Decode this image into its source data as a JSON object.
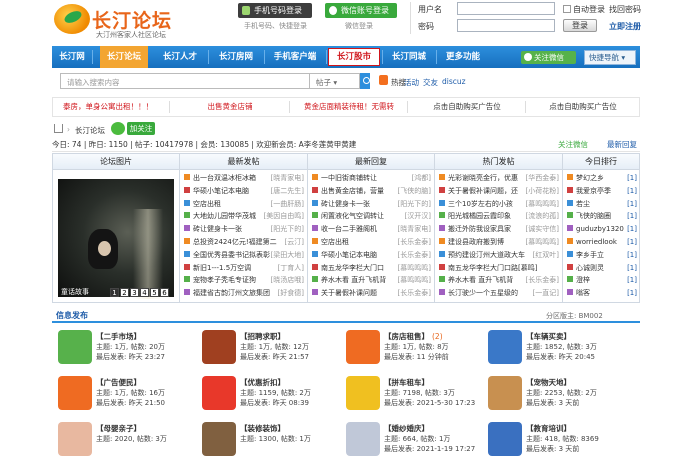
{
  "header": {
    "logo_title": "长汀论坛",
    "logo_sub": "大汀州客家人社区论坛",
    "phone_login": "手机号码登录",
    "wx_login": "微信账号登录",
    "phone_hint": "手机号码、快捷登录",
    "wx_hint": "微信登录",
    "user_label": "用户名",
    "pwd_label": "密码",
    "auto_login": "自动登录",
    "find_pwd": "找回密码",
    "login_btn": "登录",
    "register": "立即注册"
  },
  "nav": {
    "items": [
      "长汀网",
      "长汀论坛",
      "长汀人才",
      "长汀房网",
      "手机客户端",
      "长汀股市",
      "长汀同城",
      "更多功能"
    ],
    "wx_follow": "关注微信",
    "fast_nav": "快捷导航"
  },
  "search": {
    "placeholder": "请输入搜索内容",
    "scope": "帖子",
    "hot_label": "热搜:",
    "hot_keywords": [
      "活动",
      "交友",
      "discuz"
    ]
  },
  "ads": [
    "泰房，单身公寓出租！！！",
    "出售黄金店铺",
    "黄金店面精装待租！无需转",
    "点击自助购买广告位",
    "点击自助购买广告位"
  ],
  "breadcrumb": {
    "forum": "长汀论坛",
    "follow": "加关注"
  },
  "stats": {
    "text": "今日: 74 | 昨日: 1150 | 帖子: 10417978 | 会员: 130085 | 欢迎新会员: A李冬莲黄甲黄建",
    "wx_attention": "关注微信",
    "newest_reply": "最新回复"
  },
  "columns": {
    "photo_title": "论坛图片",
    "newest_title": "最新发帖",
    "reply_title": "最新回复",
    "hot_title": "热门发帖",
    "rank_title": "今日排行",
    "photo_caption": "童话故事",
    "photo_pages": [
      "1",
      "2",
      "3",
      "4",
      "5",
      "6"
    ],
    "newest": [
      {
        "t": "出一台双温冰柜冰箱",
        "u": "[晓青家电]"
      },
      {
        "t": "华硕小笔记本电脑",
        "u": "[唐二先生]"
      },
      {
        "t": "空店出租",
        "u": "[一曲肝肠]"
      },
      {
        "t": "大地幼儿园带华茂城",
        "u": "[美因自由鸣]"
      },
      {
        "t": "砖让健身卡一张",
        "u": "[阳光下的]"
      },
      {
        "t": "总投资2424亿元!福建第二",
        "u": "[云汀]"
      },
      {
        "t": "全国优秀县委书记拟表彰",
        "u": "[梁田大地]"
      },
      {
        "t": "新旧1---1.5万空调",
        "u": "[丁育人]"
      },
      {
        "t": "宠物孝子秃毛专证狗",
        "u": "[晓汤店哦]"
      },
      {
        "t": "福建省古韵汀州文旅集团",
        "u": "[好食德]"
      }
    ],
    "replies": [
      {
        "t": "一中旧街商铺转让",
        "u": "[鸿都]"
      },
      {
        "t": "出售黄金店铺，营量",
        "u": "[飞侠的脑]"
      },
      {
        "t": "砖让健身卡一张",
        "u": "[阳光下的]"
      },
      {
        "t": "闲置液化气空调转让",
        "u": "[汉开汉]"
      },
      {
        "t": "收一台二手雅阁机",
        "u": "[晓青家电]"
      },
      {
        "t": "空店出租",
        "u": "[长乐金泰]"
      },
      {
        "t": "华硕小笔记本电脑",
        "u": "[长乐金泰]"
      },
      {
        "t": "南五龙华李栏大门口",
        "u": "[慕鸣鸣鸣]"
      },
      {
        "t": "养水木看 直升飞机背",
        "u": "[慕鸣鸣鸣]"
      },
      {
        "t": "关于暑假补课问题",
        "u": "[长乐金泰]"
      }
    ],
    "hot": [
      {
        "t": "光彩谢晓亮金行，优惠",
        "u": "[华西金泰]"
      },
      {
        "t": "关于暑假补课问题，还",
        "u": "[小荷花粉]"
      },
      {
        "t": "三个10岁左右的小孩",
        "u": "[慕鸣鸣鸣]"
      },
      {
        "t": "阳光城橘园云霞印象",
        "u": "[流浪的孤]"
      },
      {
        "t": "搬迁外防我设家具家",
        "u": "[诚实守信]"
      },
      {
        "t": "建设县政府搬到博",
        "u": "[慕鸣鸣鸣]"
      },
      {
        "t": "预约建设汀州大道政大车",
        "u": "[红双叶]"
      },
      {
        "t": "南五龙华李栏大门口路[慕鸣]",
        "u": ""
      },
      {
        "t": "养水木看 直升飞机背",
        "u": "[长乐金泰]"
      },
      {
        "t": "长汀驶少一个五星级的",
        "u": "[一直记]"
      }
    ],
    "rank": [
      {
        "t": "梦幻之乡",
        "n": "[1]"
      },
      {
        "t": "我爱京亭季",
        "n": "[1]"
      },
      {
        "t": "若尘",
        "n": "[1]"
      },
      {
        "t": "飞侠的脑圈",
        "n": "[1]"
      },
      {
        "t": "guduzby1320",
        "n": "[1]"
      },
      {
        "t": "worriedlook",
        "n": "[1]"
      },
      {
        "t": "李乡手立",
        "n": "[1]"
      },
      {
        "t": "心诚则灵",
        "n": "[1]"
      },
      {
        "t": "澄梓",
        "n": "[1]"
      },
      {
        "t": "嗡客",
        "n": "[1]"
      }
    ]
  },
  "categories_header": {
    "title": "信息发布",
    "moderator": "分区版主: BM002"
  },
  "categories": [
    {
      "name": "【二手市场】",
      "extra": "",
      "sub1": "主题: 1万, 帖数: 20万",
      "sub2": "最后发表: 昨天 23:27",
      "color": "#57b14b",
      "icon": "market-icon"
    },
    {
      "name": "【招聘求职】",
      "extra": "",
      "sub1": "主题: 1万, 帖数: 12万",
      "sub2": "最后发表: 昨天 21:57",
      "color": "#a04020",
      "icon": "job-icon"
    },
    {
      "name": "【房店租售】",
      "extra": "(2)",
      "sub1": "主题: 1万, 帖数: 8万",
      "sub2": "最后发表: 11 分钟前",
      "color": "#ef6b22",
      "icon": "house-icon"
    },
    {
      "name": "【车辆买卖】",
      "extra": "",
      "sub1": "主题: 1852, 帖数: 3万",
      "sub2": "最后发表: 昨天 20:45",
      "color": "#3a78c8",
      "icon": "car-icon"
    },
    {
      "name": "【广告便民】",
      "extra": "",
      "sub1": "主题: 1万, 帖数: 16万",
      "sub2": "最后发表: 昨天 21:50",
      "color": "#ef6b22",
      "icon": "convenience-icon"
    },
    {
      "name": "【优惠折扣】",
      "extra": "",
      "sub1": "主题: 1159, 帖数: 2万",
      "sub2": "最后发表: 昨天 08:39",
      "color": "#e8382a",
      "icon": "discount-icon"
    },
    {
      "name": "【拼车租车】",
      "extra": "",
      "sub1": "主题: 7198, 帖数: 3万",
      "sub2": "最后发表: 2021-5-30 17:23",
      "color": "#f0c020",
      "icon": "carpool-icon"
    },
    {
      "name": "【宠物天地】",
      "extra": "",
      "sub1": "主题: 2253, 帖数: 2万",
      "sub2": "最后发表: 3 天前",
      "color": "#c89050",
      "icon": "pet-icon"
    },
    {
      "name": "【母婴亲子】",
      "extra": "",
      "sub1": "主题: 2020, 帖数: 3万",
      "sub2": "",
      "color": "#e8b8a0",
      "icon": "baby-icon"
    },
    {
      "name": "【装修装饰】",
      "extra": "",
      "sub1": "主题: 1300, 帖数: 1万",
      "sub2": "",
      "color": "#806040",
      "icon": "decor-icon"
    },
    {
      "name": "【婚纱婚庆】",
      "extra": "",
      "sub1": "主题: 664, 帖数: 1万",
      "sub2": "最后发表: 2021-1-19 17:27",
      "color": "#c0c8d8",
      "icon": "wedding-icon"
    },
    {
      "name": "【教育培训】",
      "extra": "",
      "sub1": "主题: 418, 帖数: 8369",
      "sub2": "最后发表: 3 天前",
      "color": "#3a70c0",
      "icon": "education-icon"
    }
  ],
  "colors": {
    "nav_blue": "#1d7bd0",
    "nav_active": "#f3a531",
    "ad_red": "#d0151b"
  }
}
